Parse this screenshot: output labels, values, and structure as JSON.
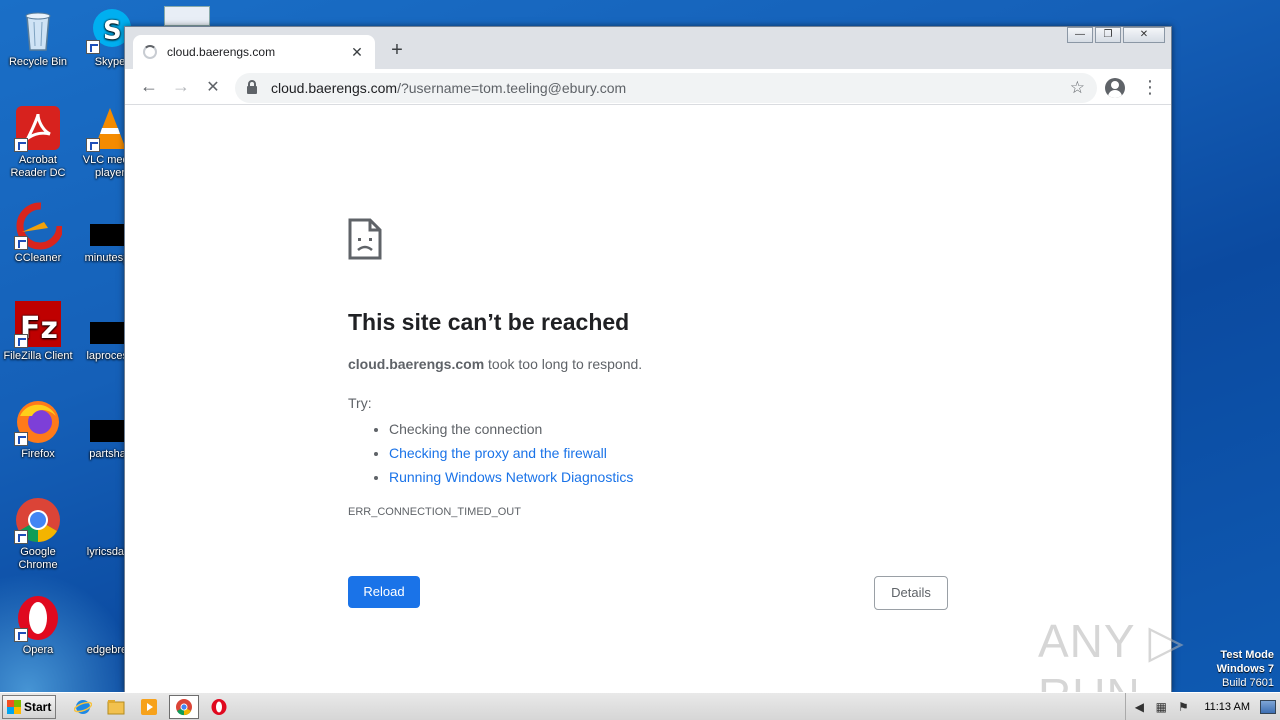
{
  "desktop": {
    "icons_col1": [
      {
        "label": "Recycle Bin"
      },
      {
        "label": "Acrobat Reader DC"
      },
      {
        "label": "CCleaner"
      },
      {
        "label": "FileZilla Client"
      },
      {
        "label": "Firefox"
      },
      {
        "label": "Google Chrome"
      },
      {
        "label": "Opera"
      }
    ],
    "icons_col2": [
      {
        "label": "Skype"
      },
      {
        "label": "VLC media player"
      },
      {
        "label": "minutespa"
      },
      {
        "label": "laprocess"
      },
      {
        "label": "partshall"
      },
      {
        "label": "lyricsdate"
      },
      {
        "label": "edgebrea"
      }
    ]
  },
  "browser": {
    "tab": {
      "title": "cloud.baerengs.com",
      "close": "✕"
    },
    "new_tab": "+",
    "window_controls": {
      "minimize": "—",
      "restore": "❐",
      "close": "✕"
    },
    "nav": {
      "back": "←",
      "forward": "→",
      "stop": "✕"
    },
    "address": {
      "host": "cloud.baerengs.com",
      "path": "/?username=tom.teeling@ebury.com"
    },
    "star": "☆",
    "menu": "⋮"
  },
  "error_page": {
    "title": "This site can’t be reached",
    "desc_host": "cloud.baerengs.com",
    "desc_rest": " took too long to respond.",
    "try_label": "Try:",
    "suggestions": [
      {
        "text": "Checking the connection",
        "link": false
      },
      {
        "text": "Checking the proxy and the firewall",
        "link": true
      },
      {
        "text": "Running Windows Network Diagnostics",
        "link": true
      }
    ],
    "error_code": "ERR_CONNECTION_TIMED_OUT",
    "reload_label": "Reload",
    "details_label": "Details"
  },
  "watermark": "ANY ▷ RUN",
  "test_mode": {
    "line1": "Test Mode",
    "line2": "Windows 7",
    "line3": "Build 7601"
  },
  "taskbar": {
    "start_label": "Start",
    "clock": "11:13 AM"
  },
  "colors": {
    "accent": "#1a73e8",
    "desktop": "#1560b8"
  }
}
